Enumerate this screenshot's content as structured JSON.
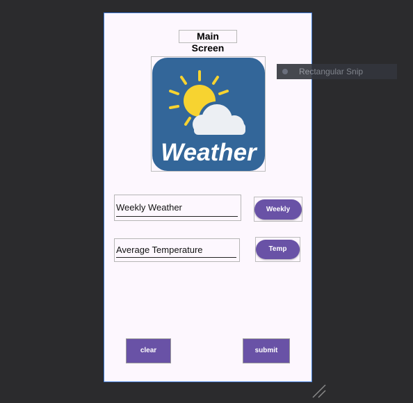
{
  "screen": {
    "title": "Main Screen"
  },
  "logo": {
    "text": "Weather",
    "bg_color": "#336699",
    "sun_color": "#f7d330",
    "cloud_color": "#eceff3"
  },
  "fields": [
    {
      "value": "Weekly Weather",
      "button_label": "Weekly"
    },
    {
      "value": "Average Temperature",
      "button_label": "Temp"
    }
  ],
  "actions": {
    "clear_label": "clear",
    "submit_label": "submit"
  },
  "overlay": {
    "snip_text": "Rectangular Snip"
  },
  "colors": {
    "accent": "#6952a6",
    "screen_bg": "#fdf7fe",
    "canvas_bg": "#2b2b2d",
    "selection_border": "#3f7bd6"
  }
}
